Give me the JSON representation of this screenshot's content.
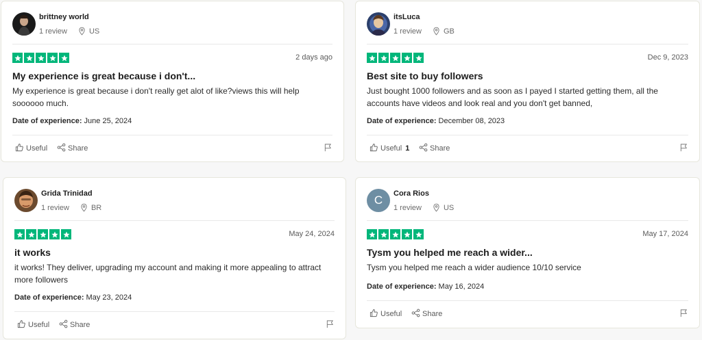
{
  "labels": {
    "date_of_experience": "Date of experience:",
    "useful": "Useful",
    "share": "Share"
  },
  "colors": {
    "star_green": "#00b67a",
    "letter_avatar": "#6e8ea3"
  },
  "reviews": [
    {
      "name": "brittney world",
      "review_count": "1 review",
      "country": "US",
      "rating": 5,
      "date": "2 days ago",
      "title": "My experience is great because i don't...",
      "body": "My experience is great because i don't really get alot of like?views this will help soooooo much.",
      "experience_date": "June 25, 2024",
      "useful_count": ""
    },
    {
      "name": "itsLuca",
      "review_count": "1 review",
      "country": "GB",
      "rating": 5,
      "date": "Dec 9, 2023",
      "title": "Best site to buy followers",
      "body": "Just bought 1000 followers and as soon as I payed I started getting them, all the accounts have videos and look real and you don't get banned,",
      "experience_date": "December 08, 2023",
      "useful_count": "1"
    },
    {
      "name": "Grida Trinidad",
      "review_count": "1 review",
      "country": "BR",
      "rating": 5,
      "date": "May 24, 2024",
      "title": "it works",
      "body": "it works! They deliver, upgrading my account and making it more appealing to attract more followers",
      "experience_date": "May 23, 2024",
      "useful_count": ""
    },
    {
      "name": "Cora Rios",
      "avatar_letter": "C",
      "review_count": "1 review",
      "country": "US",
      "rating": 5,
      "date": "May 17, 2024",
      "title": "Tysm you helped me reach a wider...",
      "body": "Tysm you helped me reach a wider audience 10/10 service",
      "experience_date": "May 16, 2024",
      "useful_count": ""
    }
  ]
}
